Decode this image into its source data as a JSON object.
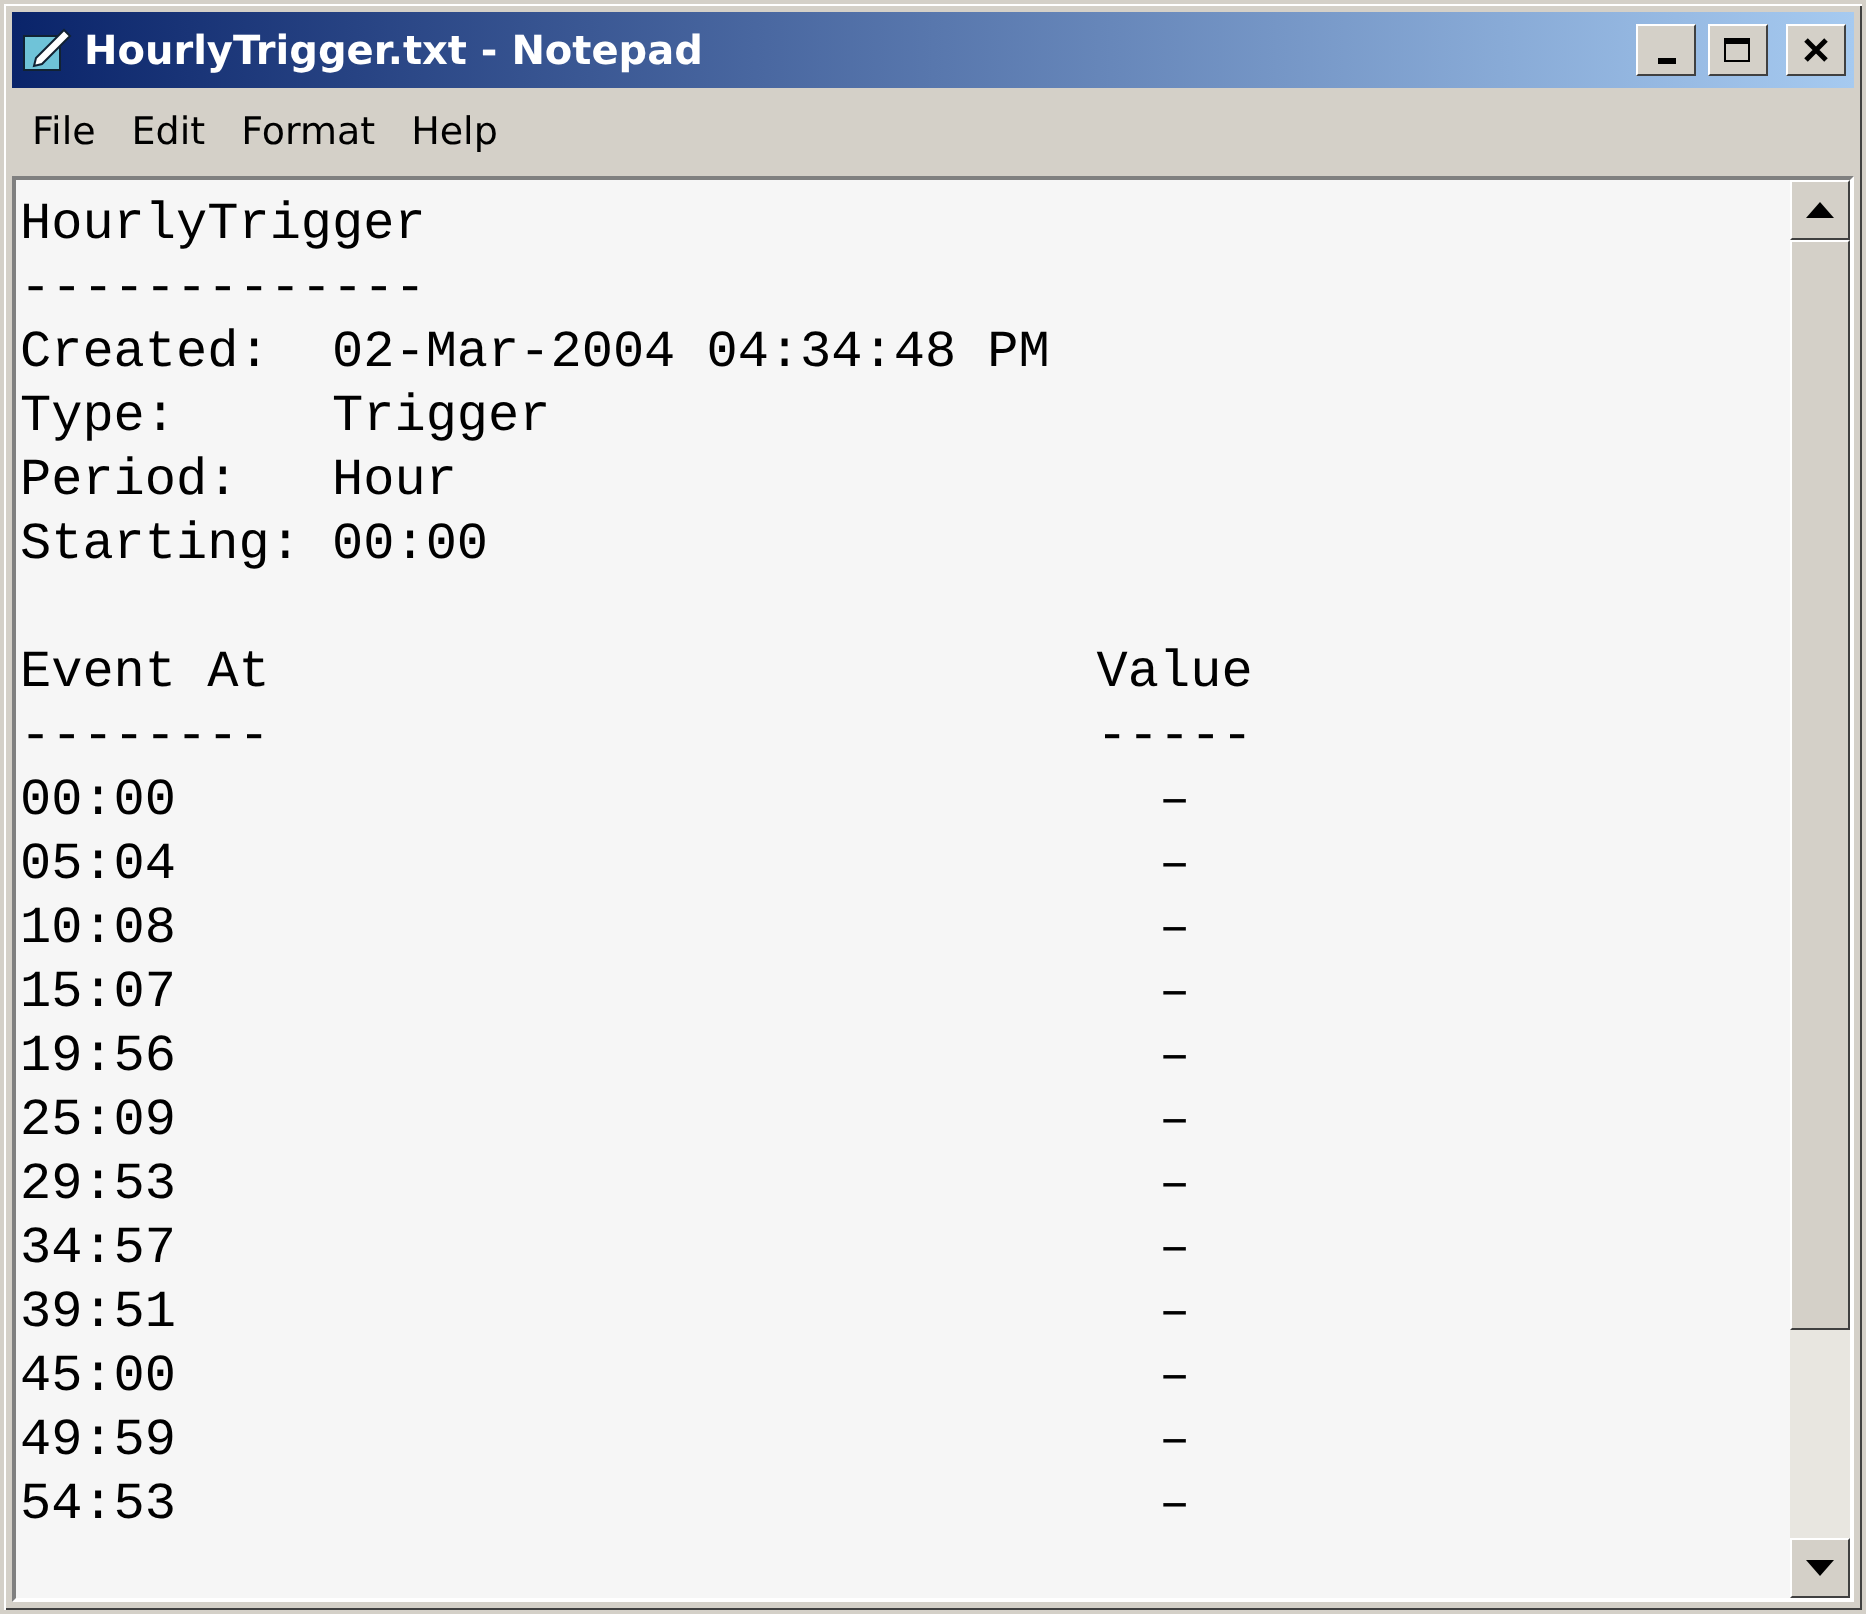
{
  "window": {
    "title": "HourlyTrigger.txt - Notepad"
  },
  "menu": [
    "File",
    "Edit",
    "Format",
    "Help"
  ],
  "document": {
    "title": "HourlyTrigger",
    "title_rule": "-------------",
    "fields": [
      {
        "label": "Created:",
        "value": "02-Mar-2004 04:34:48 PM"
      },
      {
        "label": "Type:",
        "value": "Trigger"
      },
      {
        "label": "Period:",
        "value": "Hour"
      },
      {
        "label": "Starting:",
        "value": "00:00"
      }
    ],
    "table": {
      "columns": [
        {
          "heading": "Event At",
          "rule": "--------"
        },
        {
          "heading": "Value",
          "rule": "-----"
        }
      ],
      "rows": [
        [
          "00:00",
          "–"
        ],
        [
          "05:04",
          "–"
        ],
        [
          "10:08",
          "–"
        ],
        [
          "15:07",
          "–"
        ],
        [
          "19:56",
          "–"
        ],
        [
          "25:09",
          "–"
        ],
        [
          "29:53",
          "–"
        ],
        [
          "34:57",
          "–"
        ],
        [
          "39:51",
          "–"
        ],
        [
          "45:00",
          "–"
        ],
        [
          "49:59",
          "–"
        ],
        [
          "54:53",
          "–"
        ]
      ]
    }
  }
}
